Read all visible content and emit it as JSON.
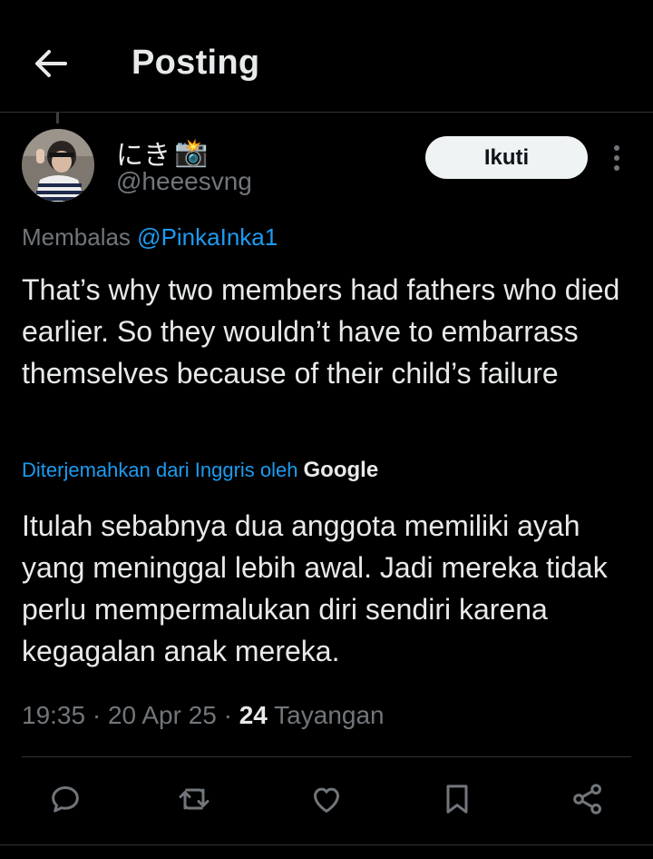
{
  "header": {
    "title": "Posting",
    "back_icon": "arrow-left-icon"
  },
  "post": {
    "author": {
      "display_name": "にき",
      "name_emoji": "📸",
      "handle": "@heeesvng"
    },
    "follow_label": "Ikuti",
    "reply_prefix": "Membalas",
    "reply_mention": "@PinkaInka1",
    "text": "That’s why two members had fathers who died earlier. So they wouldn’t have to embarrass themselves because of their child’s failure",
    "translated_by": "Diterjemahkan dari Inggris oleh",
    "translator": "Google",
    "translated_text": "Itulah sebabnya dua anggota memiliki ayah yang meninggal lebih awal. Jadi mereka tidak perlu mempermalukan diri sendiri karena kegagalan anak mereka.",
    "time": "19:35",
    "date": "20 Apr 25",
    "separator": "·",
    "views_count": "24",
    "views_label": "Tayangan"
  },
  "actions": [
    "reply-icon",
    "repost-icon",
    "like-icon",
    "bookmark-icon",
    "share-icon"
  ],
  "colors": {
    "background": "#000000",
    "text": "#e7e9ea",
    "muted": "#71767b",
    "accent": "#1d9bf0",
    "divider": "#2f3336"
  }
}
